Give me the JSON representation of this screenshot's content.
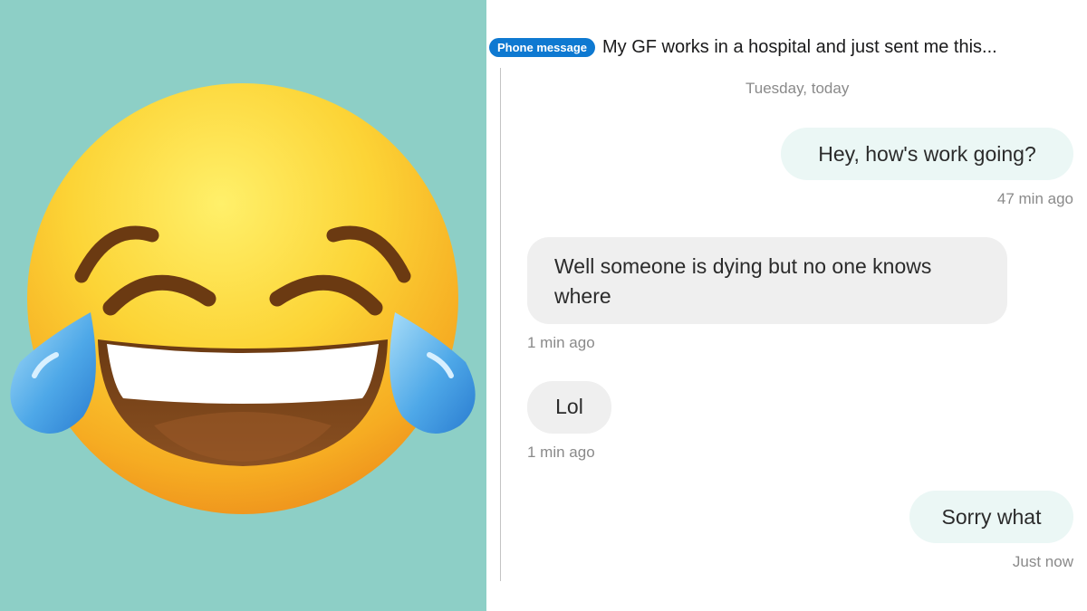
{
  "post": {
    "flair": "Phone message",
    "title": "My GF works in a hospital and just sent me this..."
  },
  "conversation": {
    "date_label": "Tuesday, today",
    "messages": [
      {
        "direction": "outgoing",
        "text": "Hey, how's work going?",
        "time": "47 min ago"
      },
      {
        "direction": "incoming",
        "text": "Well someone is dying but no one knows where",
        "time": "1 min ago"
      },
      {
        "direction": "incoming",
        "text": "Lol",
        "time": "1 min ago"
      },
      {
        "direction": "outgoing",
        "text": "Sorry what",
        "time": "Just now"
      }
    ]
  },
  "image": {
    "emoji": "face-with-tears-of-joy-icon",
    "background_color": "#8dcfc6"
  },
  "colors": {
    "flair_background": "#0e79d1",
    "outgoing_bubble": "#ebf7f5",
    "incoming_bubble": "#efefef",
    "timestamp_text": "#8a8a8a"
  }
}
